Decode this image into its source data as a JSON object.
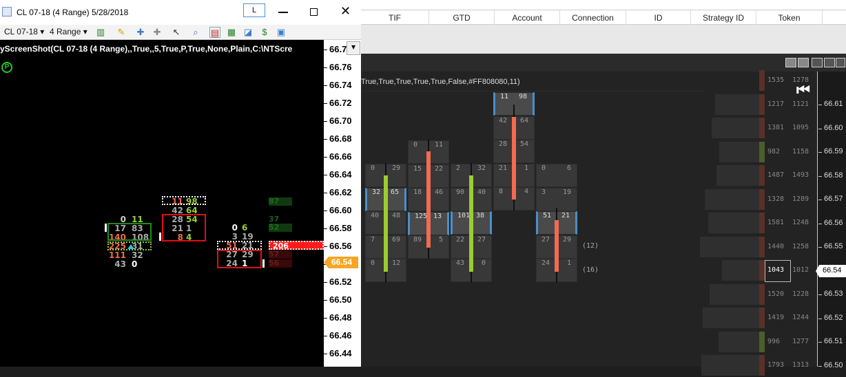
{
  "left_window": {
    "title": "CL 07-18 (4 Range)  5/28/2018",
    "l_button": "L",
    "toolbar": {
      "instrument": "CL 07-18",
      "period": "4 Range"
    },
    "chart_text": "yScreenShot(CL  07-18  (4  Range),,True,,5,True,P,True,None,Plain,C:\\NTScre",
    "p_marker": "P",
    "price_axis": [
      "66.78",
      "66.76",
      "66.74",
      "66.72",
      "66.70",
      "66.68",
      "66.66",
      "66.64",
      "66.62",
      "66.60",
      "66.58",
      "66.56",
      "66.54",
      "66.52",
      "66.50",
      "66.48",
      "66.46",
      "66.44"
    ],
    "current_price": "66.54",
    "clusters": {
      "c1": [
        [
          "0",
          "11"
        ],
        [
          "17",
          "83"
        ],
        [
          "140",
          "108"
        ],
        [
          "225",
          "31"
        ],
        [
          "111",
          "32"
        ],
        [
          "43",
          "0"
        ]
      ],
      "c2": [
        [
          "11",
          "98"
        ],
        [
          "42",
          "64"
        ],
        [
          "28",
          "54"
        ],
        [
          "21",
          "1"
        ],
        [
          "8",
          "4"
        ]
      ],
      "c3": [
        [
          "0",
          "6"
        ],
        [
          "3",
          "19"
        ],
        [
          "51",
          "21"
        ],
        [
          "27",
          "29"
        ],
        [
          "24",
          "1"
        ]
      ],
      "c4": [
        "87",
        "37",
        "52",
        "206",
        "57",
        "56"
      ]
    }
  },
  "right_window": {
    "columns": [
      "TIF",
      "GTD",
      "Account",
      "Connection",
      "ID",
      "Strategy ID",
      "Token"
    ],
    "chart_text": "True,True,True,True,True,False,#FF808080,11)",
    "price_axis": [
      "66.61",
      "66.60",
      "66.59",
      "66.58",
      "66.57",
      "66.56",
      "66.55",
      "66.54",
      "66.53",
      "66.52",
      "66.51",
      "66.50"
    ],
    "current_price": "66.54",
    "dom_volumes": [
      [
        "1535",
        "1278"
      ],
      [
        "1217",
        "1121"
      ],
      [
        "1381",
        "1095"
      ],
      [
        "982",
        "1158"
      ],
      [
        "1487",
        "1493"
      ],
      [
        "1328",
        "1289"
      ],
      [
        "1581",
        "1248"
      ],
      [
        "1440",
        "1258"
      ],
      [
        "1043",
        "1012"
      ],
      [
        "1520",
        "1228"
      ],
      [
        "1419",
        "1244"
      ],
      [
        "996",
        "1277"
      ],
      [
        "1793",
        "1313"
      ]
    ],
    "footprint": {
      "col1": [
        [
          "0",
          "29"
        ],
        [
          "32",
          "65"
        ],
        [
          "40",
          "48"
        ],
        [
          "7",
          "69"
        ],
        [
          "0",
          "12"
        ]
      ],
      "col2": [
        [
          "0",
          "11"
        ],
        [
          "15",
          "22"
        ],
        [
          "18",
          "46"
        ],
        [
          "125",
          "13"
        ],
        [
          "89",
          "5"
        ]
      ],
      "col3": [
        [
          "2",
          "32"
        ],
        [
          "90",
          "40"
        ],
        [
          "101",
          "38"
        ],
        [
          "22",
          "27"
        ],
        [
          "43",
          "0"
        ]
      ],
      "col4": [
        [
          "11",
          "98"
        ],
        [
          "42",
          "64"
        ],
        [
          "28",
          "54"
        ],
        [
          "21",
          "1"
        ],
        [
          "8",
          "4"
        ]
      ],
      "col5": [
        [
          "0",
          "6"
        ],
        [
          "3",
          "19"
        ],
        [
          "51",
          "21"
        ],
        [
          "27",
          "29"
        ],
        [
          "24",
          "1"
        ]
      ]
    },
    "paren_labels": [
      "(12)",
      "(16)"
    ]
  },
  "colors": {
    "green": "#9acd32",
    "red": "#f26b50",
    "bright_red": "#ff2020",
    "price_marker": "#f5a623",
    "highlight_blue": "#4b8fc9"
  }
}
